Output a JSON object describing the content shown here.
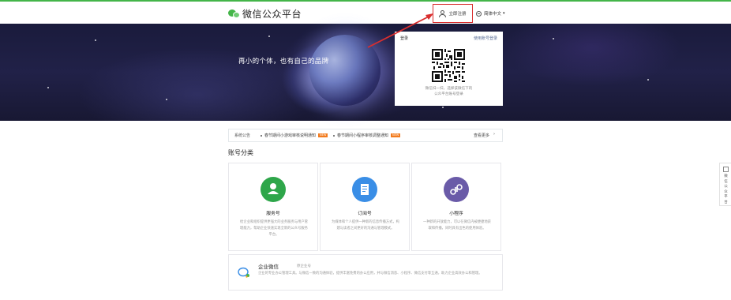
{
  "header": {
    "logo_text": "微信公众平台",
    "register_label": "立即注册",
    "language_label": "简体中文",
    "language_caret": "▾"
  },
  "banner": {
    "slogan": "再小的个体，也有自己的品牌"
  },
  "login": {
    "title": "登录",
    "switch_label": "使用账号登录",
    "qr_hint_line1": "微信扫一扫，选择该微信下的",
    "qr_hint_line2": "公众平台账号登录"
  },
  "notice": {
    "label": "系统公告",
    "items": [
      {
        "text": "春节期间小游戏审核说明通知",
        "badge": "NEW"
      },
      {
        "text": "春节期间小程序审核调整通知",
        "badge": "NEW"
      }
    ],
    "more_label": "查看更多",
    "more_arrow": "›"
  },
  "section": {
    "title": "账号分类"
  },
  "account_types": [
    {
      "name": "服务号",
      "desc": "给企业和组织提供更强大的业务服务与用户管理能力，帮助企业快速实现全新的公众号服务平台。",
      "color": "#2ea64a"
    },
    {
      "name": "订阅号",
      "desc": "为媒体和个人提供一种新的信息传播方式，构建与读者之间更好的沟通与管理模式。",
      "color": "#3a8ee6"
    },
    {
      "name": "小程序",
      "desc": "一种新的开放能力，可以在微信内被便捷地获取和传播，同时具有出色的使用体验。",
      "color": "#6a5ba8"
    }
  ],
  "enterprise": {
    "name": "企业微信",
    "sub": "原企业号",
    "desc": "企业的专业办公管理工具。与微信一致的沟通体验，提供丰富免费的办公应用，并与微信消息、小程序、微信支付等互通，助力企业高效办公和管理。"
  },
  "side_float": {
    "text": "微信公众平台"
  },
  "colors": {
    "brand_green": "#44b549",
    "highlight_red": "#d92e2e",
    "link_blue": "#576b95"
  }
}
